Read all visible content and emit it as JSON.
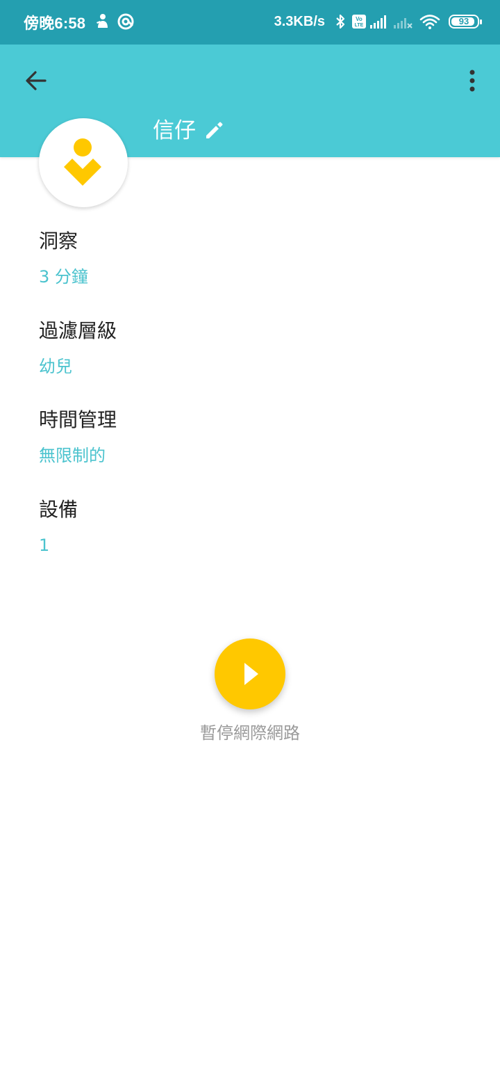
{
  "status_bar": {
    "time": "傍晚6:58",
    "net_speed": "3.3KB/s",
    "volte": "Vo LTE",
    "battery": "93",
    "battery_level": 0.93,
    "icons": [
      "notification-person-icon",
      "notification-at-icon",
      "bluetooth-icon",
      "volte-icon",
      "signal-full-icon",
      "signal-none-icon",
      "wifi-icon",
      "battery-icon"
    ]
  },
  "app_bar": {
    "back_icon": "arrow-back-icon",
    "menu_icon": "more-vert-icon",
    "profile_name": "信仔",
    "edit_icon": "pencil-icon",
    "color": "#4bcad5"
  },
  "avatar": {
    "icon": "child-avatar-icon",
    "color": "#ffc800"
  },
  "info": {
    "items": [
      {
        "label": "洞察",
        "value": "3 分鐘"
      },
      {
        "label": "過濾層級",
        "value": "幼兒"
      },
      {
        "label": "時間管理",
        "value": "無限制的"
      },
      {
        "label": "設備",
        "value": "1"
      }
    ],
    "value_color": "#4bc3ce"
  },
  "action": {
    "icon": "play-icon",
    "label": "暫停網際網路",
    "color": "#ffc800"
  }
}
